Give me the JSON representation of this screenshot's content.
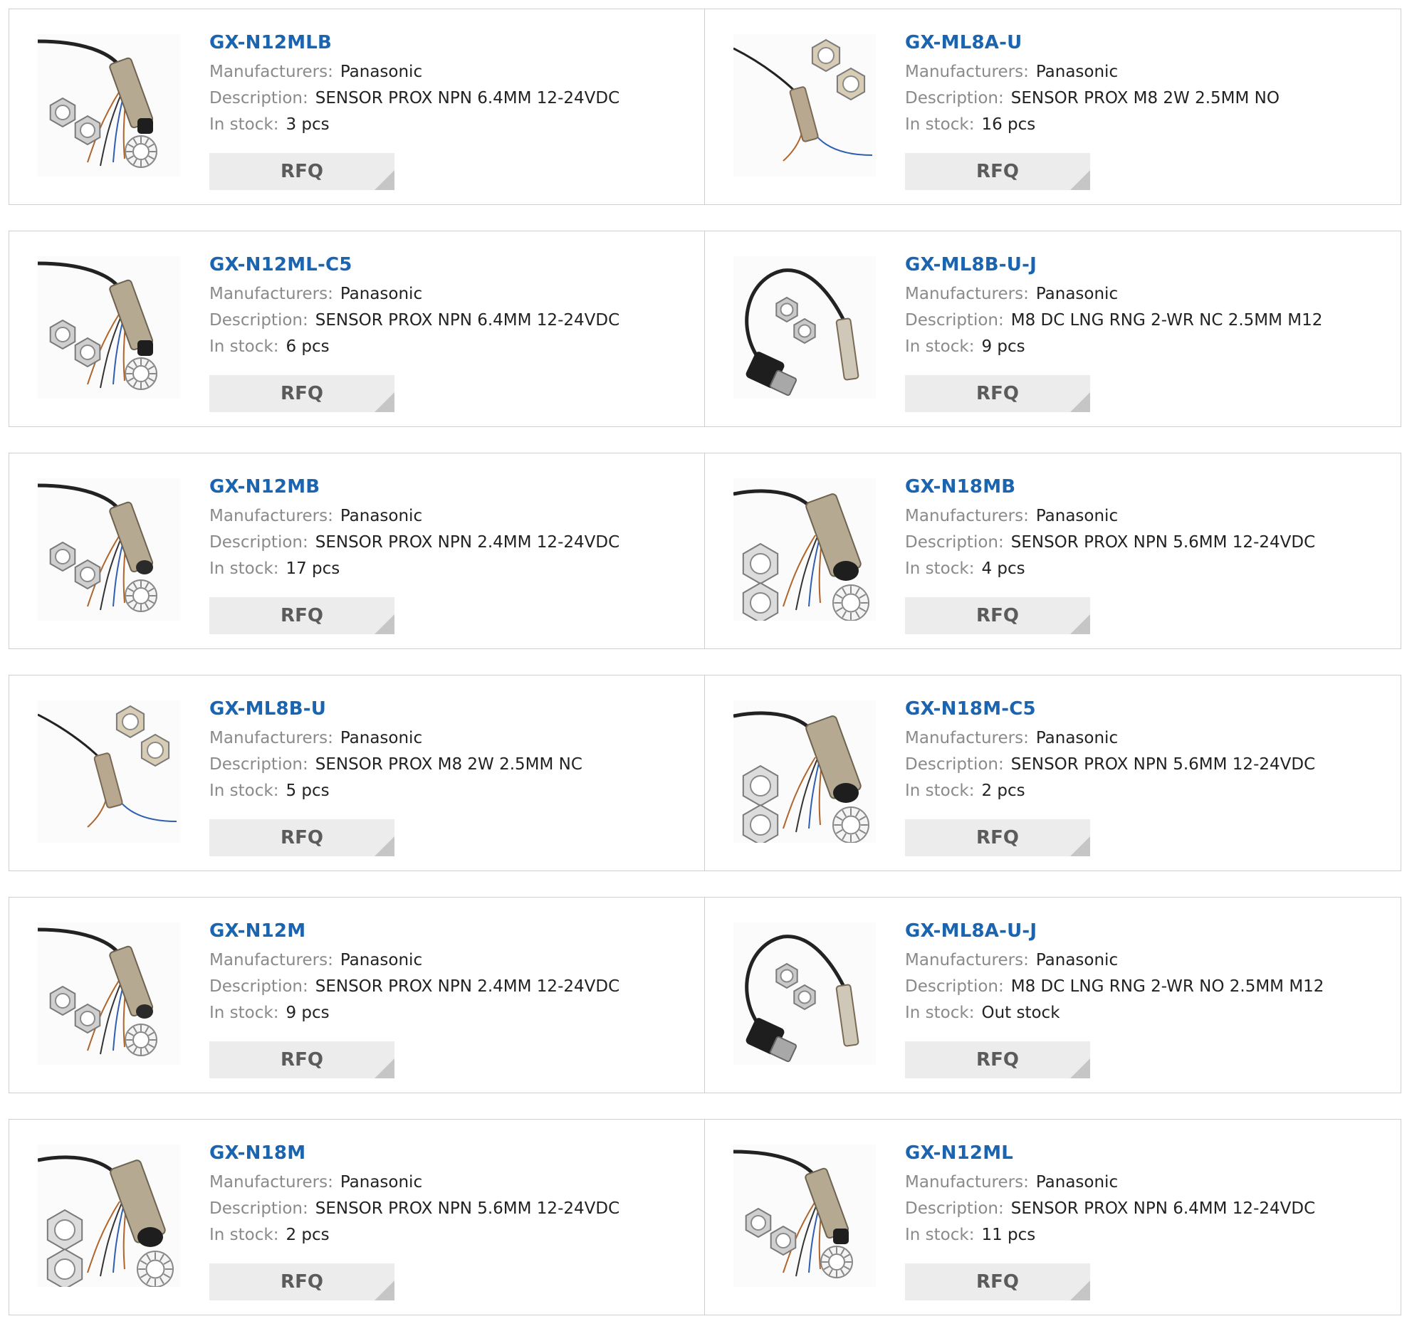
{
  "labels": {
    "manufacturers": "Manufacturers:",
    "description": "Description:",
    "in_stock": "In stock:",
    "rfq": "RFQ"
  },
  "products": [
    {
      "part": "GX-N12MLB",
      "manufacturer": "Panasonic",
      "description": "SENSOR PROX NPN 6.4MM 12-24VDC",
      "stock": "3 pcs",
      "image": "cylinder-sensor-with-cap"
    },
    {
      "part": "GX-ML8A-U",
      "manufacturer": "Panasonic",
      "description": "SENSOR PROX M8 2W 2.5MM NO",
      "stock": "16 pcs",
      "image": "thin-sensor-with-nuts"
    },
    {
      "part": "GX-N12ML-C5",
      "manufacturer": "Panasonic",
      "description": "SENSOR PROX NPN 6.4MM 12-24VDC",
      "stock": "6 pcs",
      "image": "cylinder-sensor-with-cap"
    },
    {
      "part": "GX-ML8B-U-J",
      "manufacturer": "Panasonic",
      "description": "M8 DC LNG RNG 2-WR NC 2.5MM M12",
      "stock": "9 pcs",
      "image": "sensor-with-connector"
    },
    {
      "part": "GX-N12MB",
      "manufacturer": "Panasonic",
      "description": "SENSOR PROX NPN 2.4MM 12-24VDC",
      "stock": "17 pcs",
      "image": "cylinder-sensor"
    },
    {
      "part": "GX-N18MB",
      "manufacturer": "Panasonic",
      "description": "SENSOR PROX NPN 5.6MM 12-24VDC",
      "stock": "4 pcs",
      "image": "large-cylinder-sensor"
    },
    {
      "part": "GX-ML8B-U",
      "manufacturer": "Panasonic",
      "description": "SENSOR PROX M8 2W 2.5MM NC",
      "stock": "5 pcs",
      "image": "thin-sensor-with-nuts"
    },
    {
      "part": "GX-N18M-C5",
      "manufacturer": "Panasonic",
      "description": "SENSOR PROX NPN 5.6MM 12-24VDC",
      "stock": "2 pcs",
      "image": "large-cylinder-sensor"
    },
    {
      "part": "GX-N12M",
      "manufacturer": "Panasonic",
      "description": "SENSOR PROX NPN 2.4MM 12-24VDC",
      "stock": "9 pcs",
      "image": "cylinder-sensor"
    },
    {
      "part": "GX-ML8A-U-J",
      "manufacturer": "Panasonic",
      "description": "M8 DC LNG RNG 2-WR NO 2.5MM M12",
      "stock": "Out stock",
      "image": "sensor-with-connector"
    },
    {
      "part": "GX-N18M",
      "manufacturer": "Panasonic",
      "description": "SENSOR PROX NPN 5.6MM 12-24VDC",
      "stock": "2 pcs",
      "image": "large-cylinder-sensor"
    },
    {
      "part": "GX-N12ML",
      "manufacturer": "Panasonic",
      "description": "SENSOR PROX NPN 6.4MM 12-24VDC",
      "stock": "11 pcs",
      "image": "cylinder-sensor-with-cap"
    }
  ],
  "colors": {
    "link": "#1a64b0",
    "label": "#8a8a8a",
    "value": "#222222",
    "button_bg": "#ececec",
    "button_text": "#5b5b5b",
    "border": "#cfcfcf"
  }
}
